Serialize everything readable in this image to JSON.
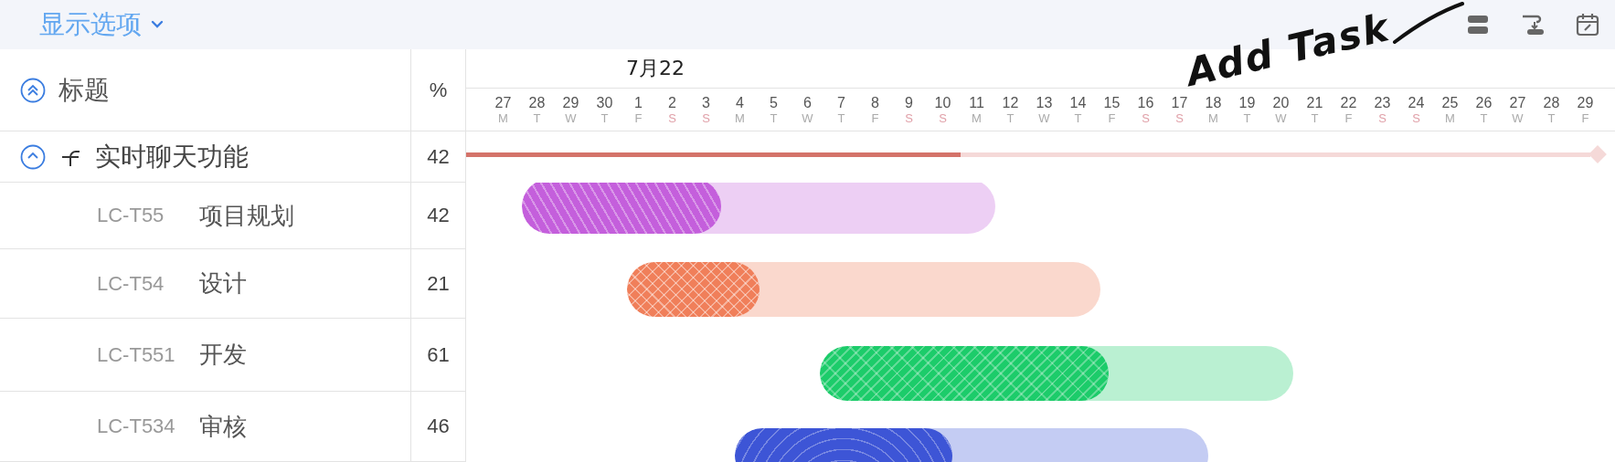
{
  "toolbar": {
    "display_options": "显示选项"
  },
  "annotation": {
    "text": "Add Task"
  },
  "columns": {
    "title": "标题",
    "percent": "%"
  },
  "timeline": {
    "month_label": "7月22",
    "days": [
      {
        "day": "27",
        "weekday": "M",
        "weekend": false
      },
      {
        "day": "28",
        "weekday": "T",
        "weekend": false
      },
      {
        "day": "29",
        "weekday": "W",
        "weekend": false
      },
      {
        "day": "30",
        "weekday": "T",
        "weekend": false
      },
      {
        "day": "1",
        "weekday": "F",
        "weekend": false
      },
      {
        "day": "2",
        "weekday": "S",
        "weekend": true
      },
      {
        "day": "3",
        "weekday": "S",
        "weekend": true
      },
      {
        "day": "4",
        "weekday": "M",
        "weekend": false
      },
      {
        "day": "5",
        "weekday": "T",
        "weekend": false
      },
      {
        "day": "6",
        "weekday": "W",
        "weekend": false
      },
      {
        "day": "7",
        "weekday": "T",
        "weekend": false
      },
      {
        "day": "8",
        "weekday": "F",
        "weekend": false
      },
      {
        "day": "9",
        "weekday": "S",
        "weekend": true
      },
      {
        "day": "10",
        "weekday": "S",
        "weekend": true
      },
      {
        "day": "11",
        "weekday": "M",
        "weekend": false
      },
      {
        "day": "12",
        "weekday": "T",
        "weekend": false
      },
      {
        "day": "13",
        "weekday": "W",
        "weekend": false
      },
      {
        "day": "14",
        "weekday": "T",
        "weekend": false
      },
      {
        "day": "15",
        "weekday": "F",
        "weekend": false
      },
      {
        "day": "16",
        "weekday": "S",
        "weekend": true
      },
      {
        "day": "17",
        "weekday": "S",
        "weekend": true
      },
      {
        "day": "18",
        "weekday": "M",
        "weekend": false
      },
      {
        "day": "19",
        "weekday": "T",
        "weekend": false
      },
      {
        "day": "20",
        "weekday": "W",
        "weekend": false
      },
      {
        "day": "21",
        "weekday": "T",
        "weekend": false
      },
      {
        "day": "22",
        "weekday": "F",
        "weekend": false
      },
      {
        "day": "23",
        "weekday": "S",
        "weekend": true
      },
      {
        "day": "24",
        "weekday": "S",
        "weekend": true
      },
      {
        "day": "25",
        "weekday": "M",
        "weekend": false
      },
      {
        "day": "26",
        "weekday": "T",
        "weekend": false
      },
      {
        "day": "27",
        "weekday": "W",
        "weekend": false
      },
      {
        "day": "28",
        "weekday": "T",
        "weekend": false
      },
      {
        "day": "29",
        "weekday": "F",
        "weekend": false
      }
    ]
  },
  "group": {
    "name": "实时聊天功能",
    "percent": "42",
    "expanded": true,
    "level": 0.44
  },
  "tasks": [
    {
      "id": "LC-T55",
      "name": "项目规划",
      "percent": "42",
      "color": "#c45fdc",
      "level": 0.42
    },
    {
      "id": "LC-T54",
      "name": "设计",
      "percent": "21",
      "color": "#f07f5a",
      "level": 0.28
    },
    {
      "id": "LC-T551",
      "name": "开发",
      "percent": "61",
      "color": "#1ccc6a",
      "level": 0.61
    },
    {
      "id": "LC-T534",
      "name": "审核",
      "percent": "46",
      "color": "#3d55d6",
      "level": 0.46
    }
  ]
}
